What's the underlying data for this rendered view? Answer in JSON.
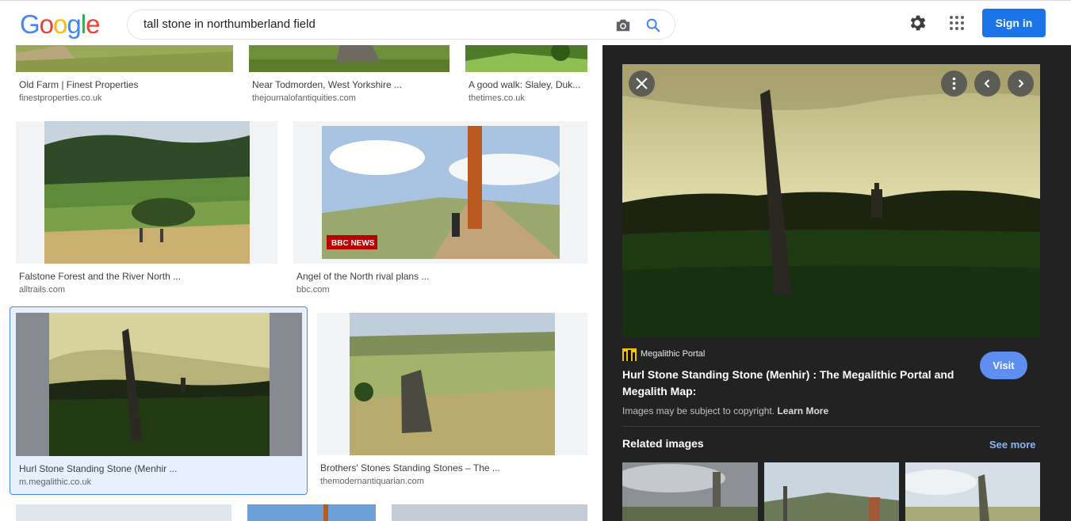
{
  "header": {
    "logo_letters": [
      {
        "ch": "G",
        "color": "#4285F4"
      },
      {
        "ch": "o",
        "color": "#EA4335"
      },
      {
        "ch": "o",
        "color": "#FBBC05"
      },
      {
        "ch": "g",
        "color": "#4285F4"
      },
      {
        "ch": "l",
        "color": "#34A853"
      },
      {
        "ch": "e",
        "color": "#EA4335"
      }
    ],
    "search_query": "tall stone in northumberland field",
    "sign_in_label": "Sign in",
    "icons": [
      "camera-icon",
      "search-icon",
      "gear-icon",
      "apps-grid-icon"
    ]
  },
  "results": [
    {
      "title": "Old Farm | Finest Properties",
      "source": "finestproperties.co.uk"
    },
    {
      "title": "Near Todmorden, West Yorkshire ...",
      "source": "thejournalofantiquities.com"
    },
    {
      "title": "A good walk: Slaley, Duk...",
      "source": "thetimes.co.uk"
    },
    {
      "title": "Falstone Forest and the River North ...",
      "source": "alltrails.com"
    },
    {
      "title": "Angel of the North rival plans ...",
      "source": "bbc.com",
      "badge": "BBC NEWS"
    },
    {
      "title": "Hurl Stone Standing Stone (Menhir ...",
      "source": "m.megalithic.co.uk"
    },
    {
      "title": "Brothers' Stones Standing Stones – The ...",
      "source": "themodernantiquarian.com"
    }
  ],
  "panel": {
    "source_name": "Megalithic Portal",
    "title": "Hurl Stone Standing Stone (Menhir) : The Megalithic Portal and Megalith Map:",
    "visit_label": "Visit",
    "copyright_text": "Images may be subject to copyright.",
    "learn_more": "Learn More",
    "related_label": "Related images",
    "see_more": "See more"
  },
  "colors": {
    "accent": "#1a73e8",
    "panel_bg": "#222222",
    "selected_bg": "#e8f0fe",
    "selected_border": "#4285f4"
  }
}
